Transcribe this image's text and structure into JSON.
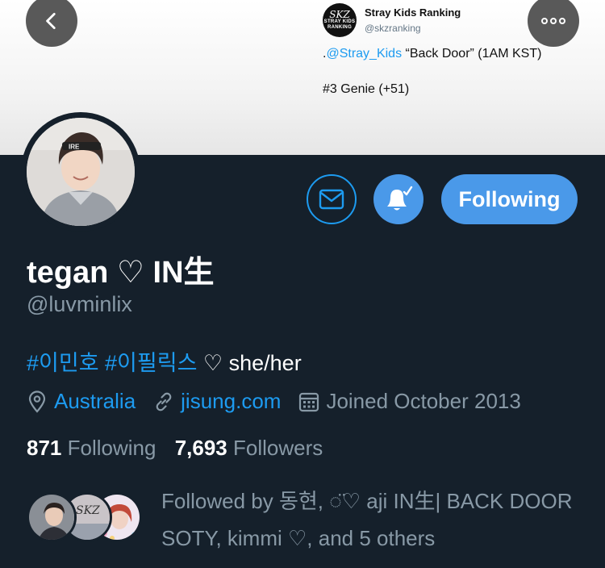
{
  "nav": {
    "back_icon": "chevron-left-icon",
    "more_icon": "more-horizontal-icon"
  },
  "banner_tweet": {
    "author_name": "Stray Kids Ranking",
    "author_handle": "@skzranking",
    "logo_top": "SKZ",
    "logo_line1": "STRAY KIDS",
    "logo_line2": "RANKING",
    "text_prefix": ".",
    "text_mention": "@Stray_Kids",
    "text_rest": " “Back Door” (1AM KST)",
    "line2": "#3 Genie (+51)"
  },
  "actions": {
    "message_icon": "mail-icon",
    "notify_icon": "bell-check-icon",
    "follow_label": "Following"
  },
  "profile": {
    "display_name": "tegan ♡ IN生",
    "handle": "@luvminlix",
    "bio_tags": "#이민호 #이필릭스",
    "bio_rest": " ♡ she/her",
    "location": "Australia",
    "website": "jisung.com",
    "joined": "Joined October 2013",
    "following_count": "871",
    "following_label": "Following",
    "followers_count": "7,693",
    "followers_label": "Followers",
    "followed_by": "Followed by 동현, ◌̈♡ aji IN生| BACK DOOR SOTY, kimmi ♡, and 5 others",
    "mini_badge_text": "SKZ"
  },
  "colors": {
    "background": "#15202b",
    "accent": "#1d9bf0",
    "button": "#4a99e9",
    "secondary_text": "#8899a6"
  }
}
